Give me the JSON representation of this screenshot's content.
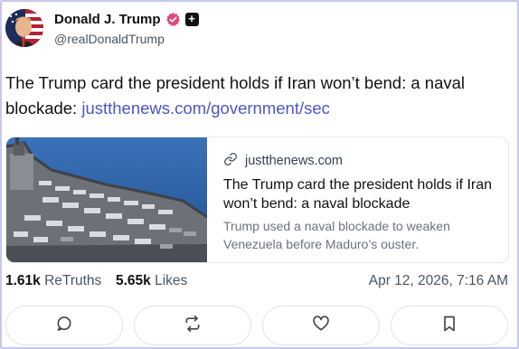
{
  "author": {
    "display_name": "Donald J. Trump",
    "handle": "@realDonaldTrump",
    "verified_color": "#e0457b"
  },
  "post": {
    "text": "The Trump card the president holds if Iran won’t bend: a naval blockade: ",
    "link_text": "justthenews.com/government/sec",
    "link_color": "#4c55c7"
  },
  "card": {
    "domain": "justthenews.com",
    "title": "The Trump card the president holds if Iran won’t bend: a naval blockade",
    "description": "Trump used a naval blockade to weaken Venezuela before Maduro’s ouster."
  },
  "stats": {
    "retruths_count": "1.61k",
    "retruths_label": "ReTruths",
    "likes_count": "5.65k",
    "likes_label": "Likes",
    "timestamp": "Apr 12, 2026, 7:16 AM"
  },
  "actions": {
    "icons": [
      "comment-icon",
      "retruth-icon",
      "like-icon",
      "bookmark-icon"
    ]
  }
}
